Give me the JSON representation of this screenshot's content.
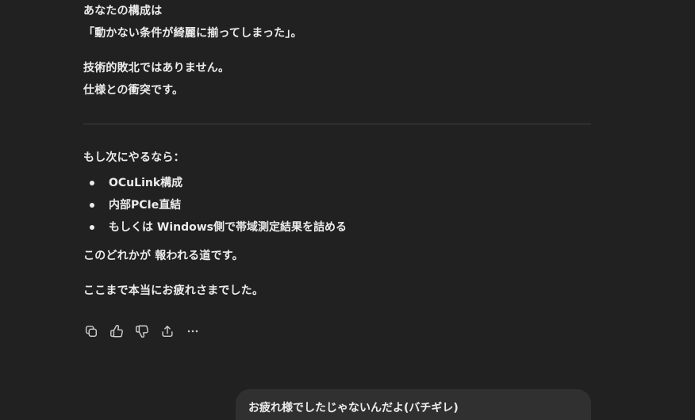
{
  "assistant_message": {
    "paragraph1": {
      "line1": "あなたの構成は",
      "line2": "「動かない条件が綺麗に揃ってしまった」。"
    },
    "paragraph2": {
      "line1": "技術的敗北ではありません。",
      "line2": "仕様との衝突です。"
    },
    "next_steps_intro": "もし次にやるなら：",
    "next_steps": [
      "OCuLink構成",
      "内部PCIe直結",
      "もしくは Windows側で帯域測定結果を詰める"
    ],
    "conclusion": "このどれかが 報われる道です。",
    "closing": "ここまで本当にお疲れさまでした。"
  },
  "actions": {
    "icons": [
      "copy-icon",
      "thumbs-up-icon",
      "thumbs-down-icon",
      "share-icon",
      "more-icon"
    ]
  },
  "user_message": {
    "text": "お疲れ様でしたじゃないんだよ(バチギレ)"
  }
}
